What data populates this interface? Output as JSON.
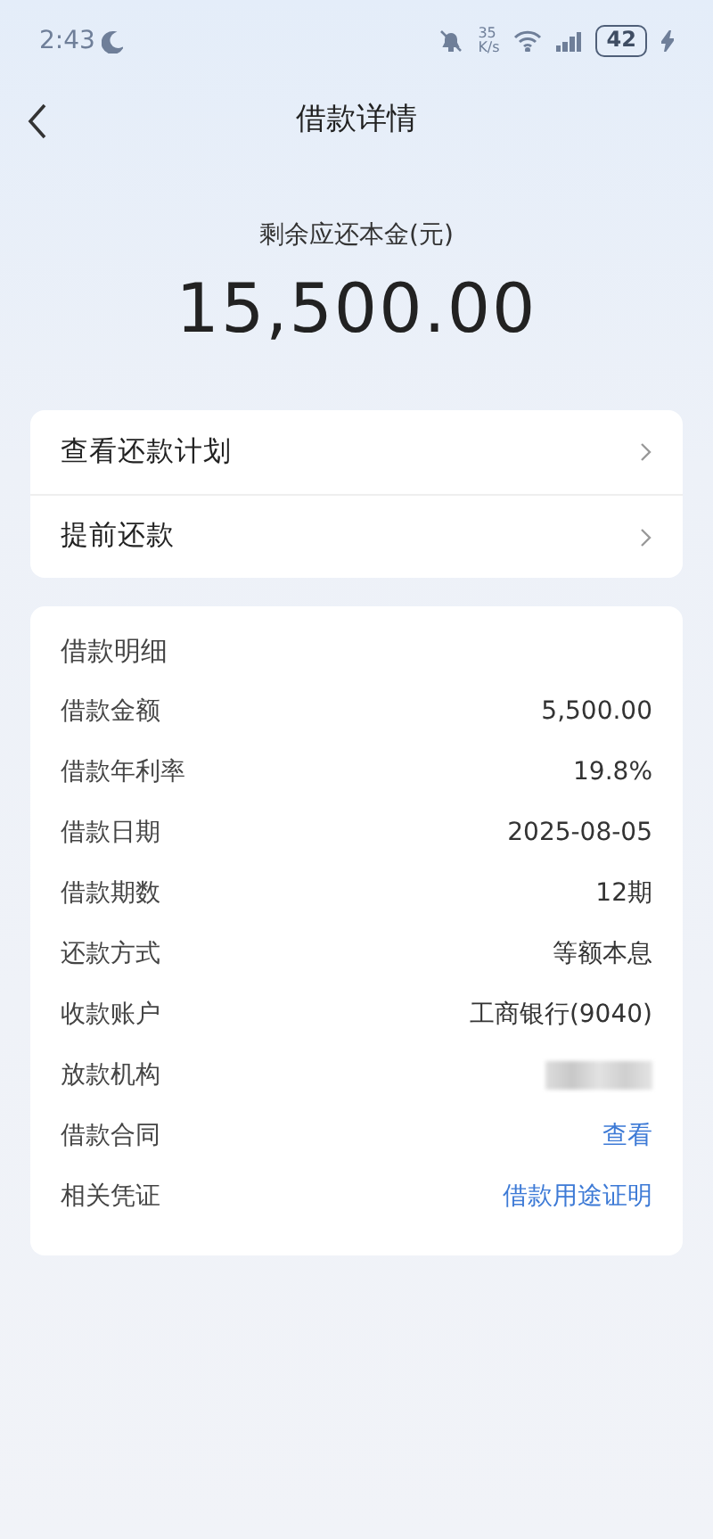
{
  "status_bar": {
    "time": "2:43",
    "speed_value": "35",
    "speed_unit": "K/s",
    "battery": "42"
  },
  "header": {
    "title": "借款详情"
  },
  "summary": {
    "label": "剩余应还本金(元)",
    "amount": "15,500.00"
  },
  "actions": [
    {
      "label": "查看还款计划"
    },
    {
      "label": "提前还款"
    }
  ],
  "details": {
    "title": "借款明细",
    "rows": [
      {
        "label": "借款金额",
        "kind": "text",
        "value": "5,500.00"
      },
      {
        "label": "借款年利率",
        "kind": "text",
        "value": "19.8%"
      },
      {
        "label": "借款日期",
        "kind": "text",
        "value": "2025-08-05"
      },
      {
        "label": "借款期数",
        "kind": "text",
        "value": "12期"
      },
      {
        "label": "还款方式",
        "kind": "text",
        "value": "等额本息"
      },
      {
        "label": "收款账户",
        "kind": "text",
        "value": "工商银行(9040)"
      },
      {
        "label": "放款机构",
        "kind": "blurred"
      },
      {
        "label": "借款合同",
        "kind": "link",
        "value": "查看"
      },
      {
        "label": "相关凭证",
        "kind": "link",
        "value": "借款用途证明"
      }
    ]
  }
}
